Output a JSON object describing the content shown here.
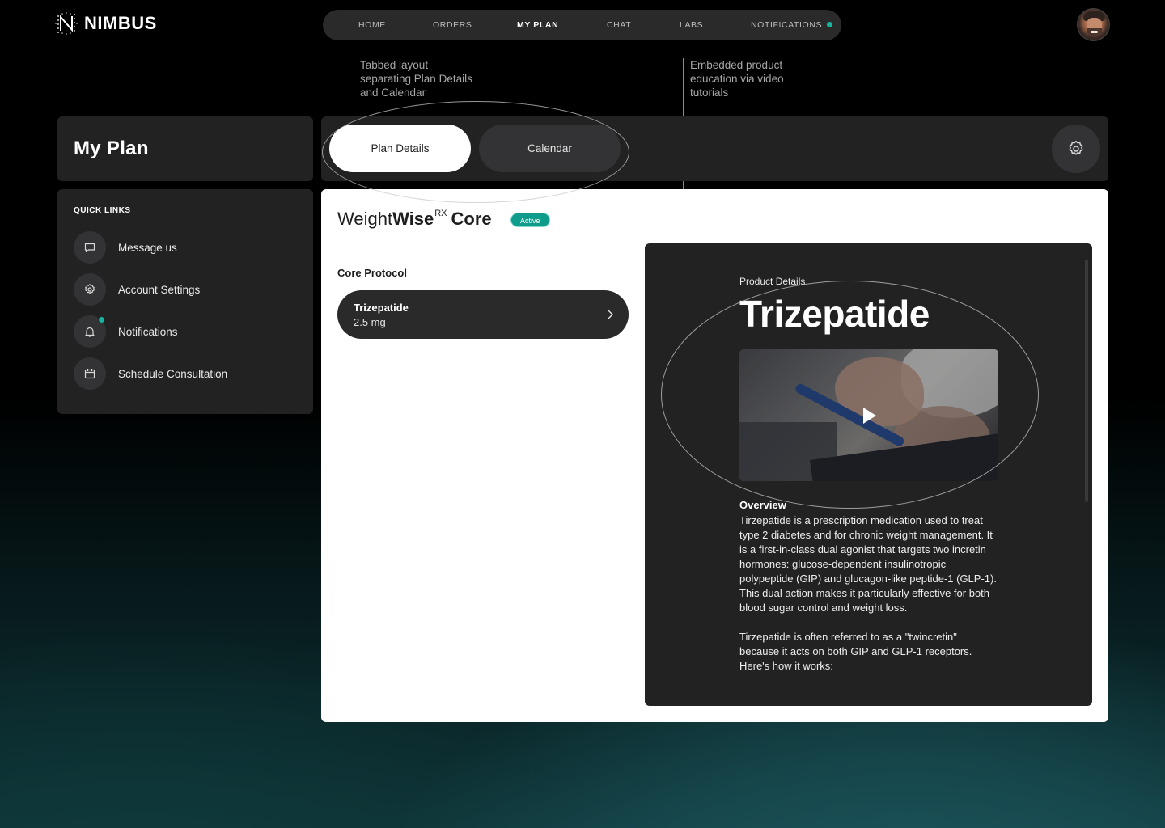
{
  "brand": {
    "name": "NIMBUS"
  },
  "nav": {
    "items": [
      {
        "label": "HOME"
      },
      {
        "label": "ORDERS"
      },
      {
        "label": "MY PLAN"
      },
      {
        "label": "CHAT"
      },
      {
        "label": "LABS"
      },
      {
        "label": "NOTIFICATIONS"
      }
    ],
    "active": "MY PLAN"
  },
  "annotations": {
    "tabs": "Tabbed layout separating Plan Details and Calendar",
    "video": "Embedded product education via video tutorials"
  },
  "sidebar": {
    "page_title": "My Plan",
    "quick_links_title": "QUICK LINKS",
    "items": [
      {
        "label": "Message us",
        "icon": "chat-bubble-icon"
      },
      {
        "label": "Account Settings",
        "icon": "gear-icon"
      },
      {
        "label": "Notifications",
        "icon": "bell-icon",
        "has_badge": true
      },
      {
        "label": "Schedule Consultation",
        "icon": "calendar-icon"
      }
    ]
  },
  "tabs": [
    {
      "label": "Plan Details",
      "active": true
    },
    {
      "label": "Calendar",
      "active": false
    }
  ],
  "plan": {
    "title_light": "Weight",
    "title_bold": "Wise",
    "title_sup": "RX",
    "title_suffix": "Core",
    "status": "Active",
    "section_title": "Core Protocol",
    "medication": {
      "name": "Trizepatide",
      "dose": "2.5 mg"
    }
  },
  "product": {
    "eyebrow": "Product Details",
    "name": "Trizepatide",
    "overview_title": "Overview",
    "paragraphs": [
      "Tirzepatide is a prescription medication used to treat type 2 diabetes and for chronic weight management. It is a first-in-class dual agonist that targets two incretin hormones: glucose-dependent insulinotropic polypeptide (GIP) and glucagon-like peptide-1 (GLP-1). This dual action makes it particularly effective for both blood sugar control and weight loss.",
      "Tirzepatide is often referred to as a \"twincretin\" because it acts on both GIP and GLP-1 receptors. Here's how it works:"
    ]
  },
  "colors": {
    "accent": "#16b3a0",
    "badge": "#0f9c8a",
    "panel": "#222223",
    "surface": "#333335"
  }
}
